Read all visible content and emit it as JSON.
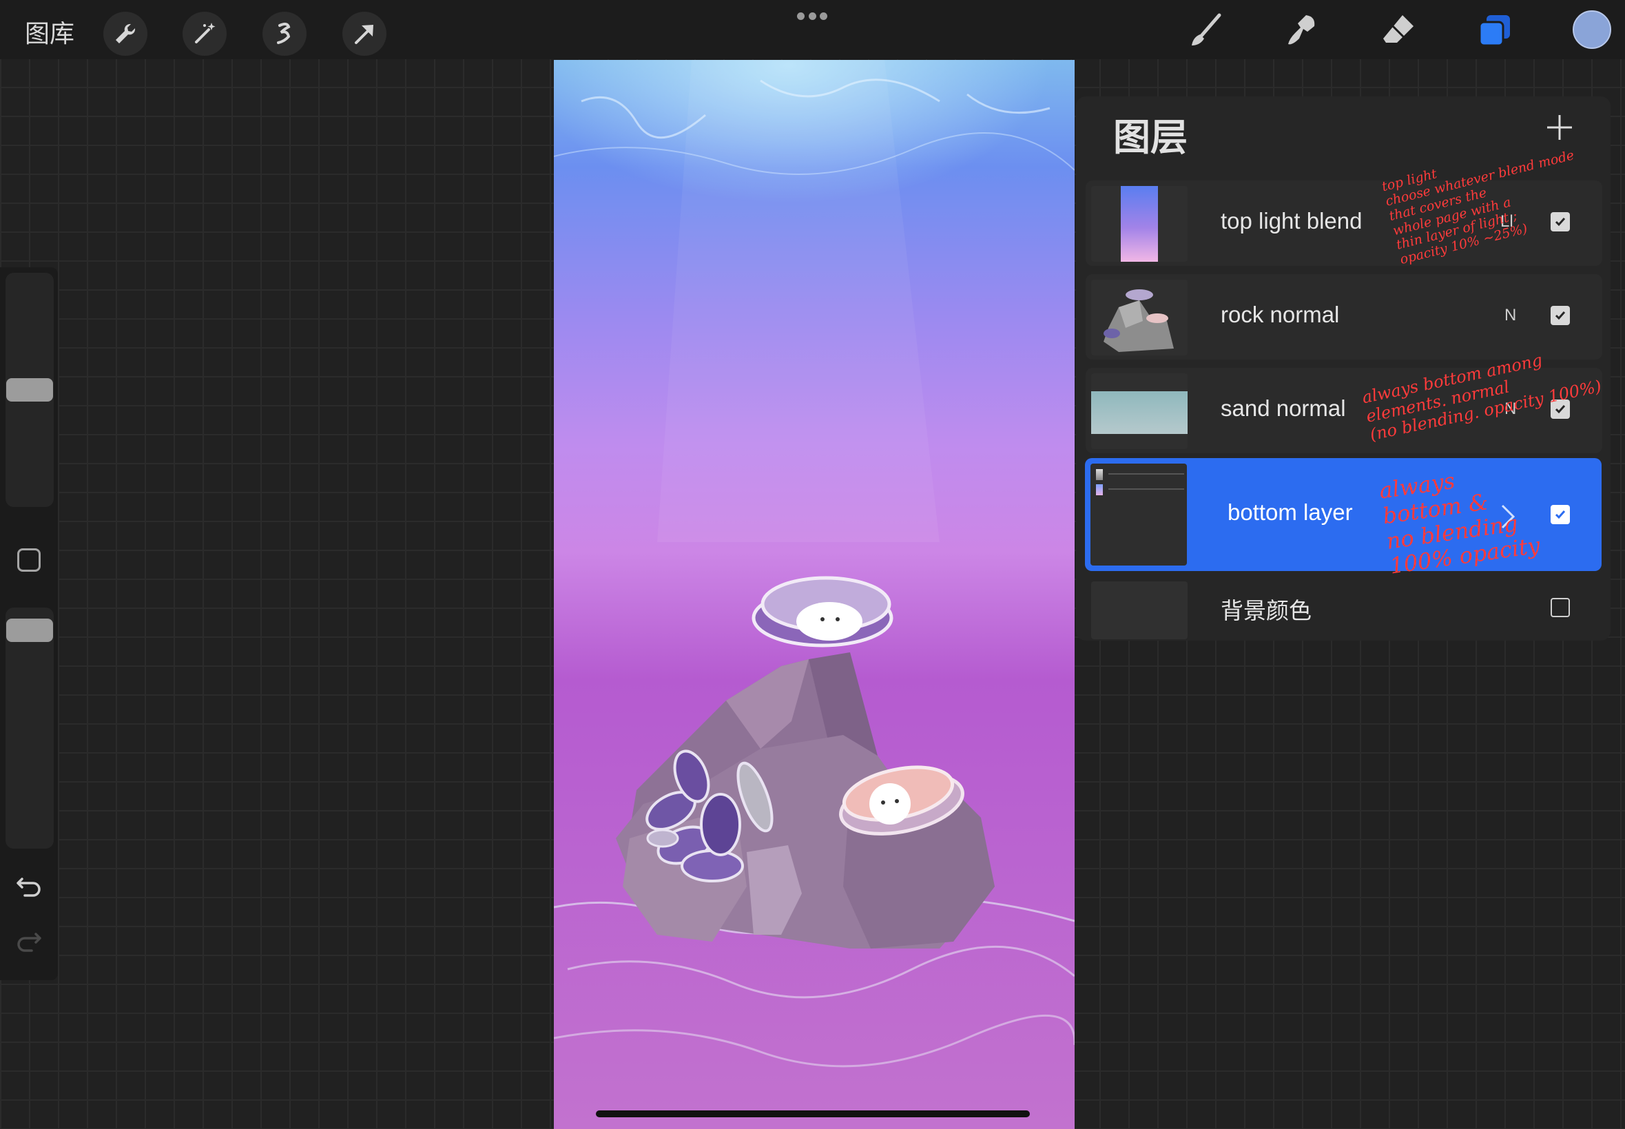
{
  "toolbar": {
    "gallery_label": "图库",
    "left_tools": [
      "wrench-icon",
      "magic-wand-icon",
      "selection-icon",
      "transform-arrow-icon"
    ],
    "right_tools": [
      "brush-icon",
      "smudge-icon",
      "eraser-icon",
      "layers-icon"
    ],
    "active_tool": "layers-icon",
    "color_swatch": "#8aa4d8"
  },
  "sidebar": {
    "brush_size_level": 0.5,
    "opacity_level": 0.95
  },
  "layers_panel": {
    "title": "图层",
    "layers": [
      {
        "name": "top light blend",
        "blend_mode": "Ll",
        "visible": true,
        "selected": false
      },
      {
        "name": "rock normal",
        "blend_mode": "N",
        "visible": true,
        "selected": false
      },
      {
        "name": "sand normal",
        "blend_mode": "N",
        "visible": true,
        "selected": false
      },
      {
        "name": "bottom layer",
        "blend_mode": "",
        "visible": true,
        "selected": true
      },
      {
        "name": "背景颜色",
        "blend_mode": "",
        "visible": false,
        "selected": false
      }
    ]
  },
  "notes": {
    "top_light": "top light\nchoose whatever blend mode\nthat covers the\nwhole page with a\nthin layer of light ;\nopacity 10% ~25%)",
    "sand": "always bottom among\nelements. normal\n(no blending. opacity 100%)",
    "bottom": "always\nbottom &\nno blending\n100% opacity"
  },
  "colors": {
    "accent": "#2c6cf0",
    "annotation": "#ff3b3b",
    "bg": "#212121"
  }
}
